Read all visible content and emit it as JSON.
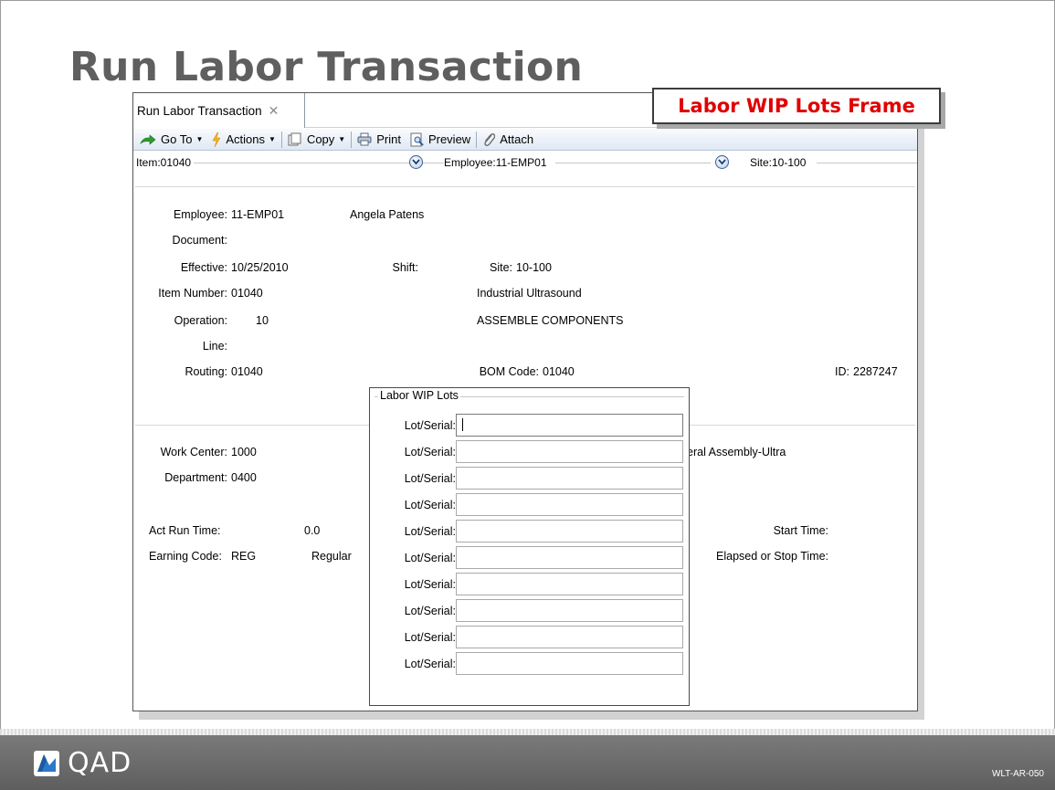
{
  "slide": {
    "title": "Run Labor Transaction",
    "callout": "Labor WIP Lots Frame",
    "brand": "QAD",
    "code": "WLT-AR-050"
  },
  "tab": {
    "label": "Run Labor Transaction",
    "close": "✕"
  },
  "toolbar": {
    "goto": "Go To",
    "actions": "Actions",
    "copy": "Copy",
    "print": "Print",
    "preview": "Preview",
    "attach": "Attach"
  },
  "selector": {
    "item": "Item:01040",
    "employee": "Employee:11-EMP01",
    "site": "Site:10-100"
  },
  "form": {
    "employee_label": "Employee:",
    "employee_value": "11-EMP01",
    "employee_name": "Angela Patens",
    "document_label": "Document:",
    "effective_label": "Effective:",
    "effective_value": "10/25/2010",
    "shift_label": "Shift:",
    "site_label": "Site:",
    "site_value": "10-100",
    "item_label": "Item Number:",
    "item_value": "01040",
    "item_desc": "Industrial Ultrasound",
    "operation_label": "Operation:",
    "operation_value": "10",
    "operation_desc": "ASSEMBLE COMPONENTS",
    "line_label": "Line:",
    "routing_label": "Routing:",
    "routing_value": "01040",
    "bom_label": "BOM Code:",
    "bom_value": "01040",
    "id_label": "ID:",
    "id_value": "2287247",
    "work_center_label": "Work Center:",
    "work_center_value": "1000",
    "work_center_desc": "eral Assembly-Ultra",
    "department_label": "Department:",
    "department_value": "0400",
    "act_run_label": "Act Run Time:",
    "act_run_value": "0.0",
    "start_time_label": "Start Time:",
    "earning_label": "Earning Code:",
    "earning_value": "REG",
    "earning_desc": "Regular",
    "elapsed_label": "Elapsed or Stop Time:"
  },
  "wip": {
    "title": "Labor WIP Lots",
    "rows": [
      {
        "label": "Lot/Serial:",
        "value": ""
      },
      {
        "label": "Lot/Serial:",
        "value": ""
      },
      {
        "label": "Lot/Serial:",
        "value": ""
      },
      {
        "label": "Lot/Serial:",
        "value": ""
      },
      {
        "label": "Lot/Serial:",
        "value": ""
      },
      {
        "label": "Lot/Serial:",
        "value": ""
      },
      {
        "label": "Lot/Serial:",
        "value": ""
      },
      {
        "label": "Lot/Serial:",
        "value": ""
      },
      {
        "label": "Lot/Serial:",
        "value": ""
      },
      {
        "label": "Lot/Serial:",
        "value": ""
      }
    ]
  }
}
